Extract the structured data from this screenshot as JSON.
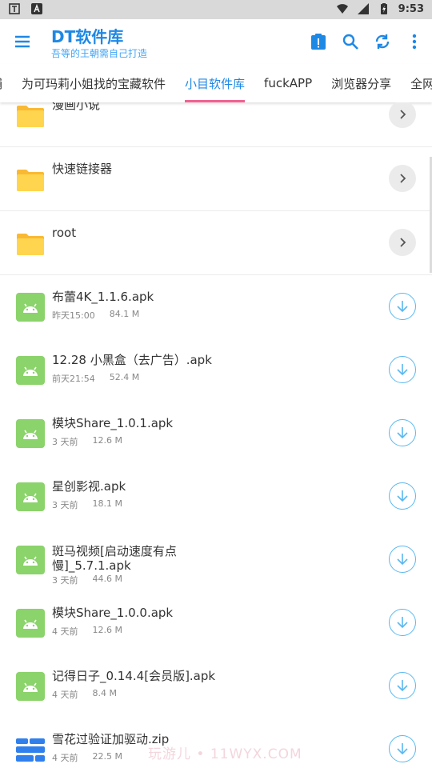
{
  "status_bar": {
    "time": "9:53",
    "left_icons": [
      "carrier-icon",
      "notification-a-icon"
    ],
    "right_icons": [
      "wifi-icon",
      "signal-icon",
      "battery-icon"
    ]
  },
  "app_bar": {
    "title": "DT软件库",
    "subtitle": "吾等的王朝需自己打造",
    "icons": [
      "menu-icon",
      "clipboard-info-icon",
      "search-icon",
      "sync-icon",
      "more-vert-icon"
    ],
    "accent": "#1e88e5"
  },
  "tabs": [
    {
      "label": "铺",
      "active": false
    },
    {
      "label": "为可玛莉小姐找的宝藏软件",
      "active": false
    },
    {
      "label": "小目软件库",
      "active": true
    },
    {
      "label": "fuckAPP",
      "active": false
    },
    {
      "label": "浏览器分享",
      "active": false
    },
    {
      "label": "全网最",
      "active": false
    }
  ],
  "items": [
    {
      "type": "folder",
      "name": "漫画小说"
    },
    {
      "type": "folder",
      "name": "快速链接器"
    },
    {
      "type": "folder",
      "name": "root"
    },
    {
      "type": "apk",
      "name": "布蕾4K_1.1.6.apk",
      "time": "昨天15:00",
      "size": "84.1 M"
    },
    {
      "type": "apk",
      "name": "12.28 小黑盒（去广告）.apk",
      "time": "前天21:54",
      "size": "52.4 M"
    },
    {
      "type": "apk",
      "name": "模块Share_1.0.1.apk",
      "time": "3 天前",
      "size": "12.6 M"
    },
    {
      "type": "apk",
      "name": "星创影视.apk",
      "time": "3 天前",
      "size": "18.1 M"
    },
    {
      "type": "apk",
      "name": "斑马视频[启动速度有点慢]_5.7.1.apk",
      "time": "3 天前",
      "size": "44.6 M"
    },
    {
      "type": "apk",
      "name": "模块Share_1.0.0.apk",
      "time": "4 天前",
      "size": "12.6 M"
    },
    {
      "type": "apk",
      "name": "记得日子_0.14.4[会员版].apk",
      "time": "4 天前",
      "size": "8.4 M"
    },
    {
      "type": "zip",
      "name": "雪花过验证加驱动.zip",
      "time": "4 天前",
      "size": "22.5 M"
    }
  ],
  "watermark": "玩游儿 • 11WYX.COM",
  "colors": {
    "folder": "#ffd54f",
    "apk": "#8bd36b",
    "zip": "#2f80ed",
    "download": "#59b8f0",
    "tab_indicator": "#f06292"
  }
}
